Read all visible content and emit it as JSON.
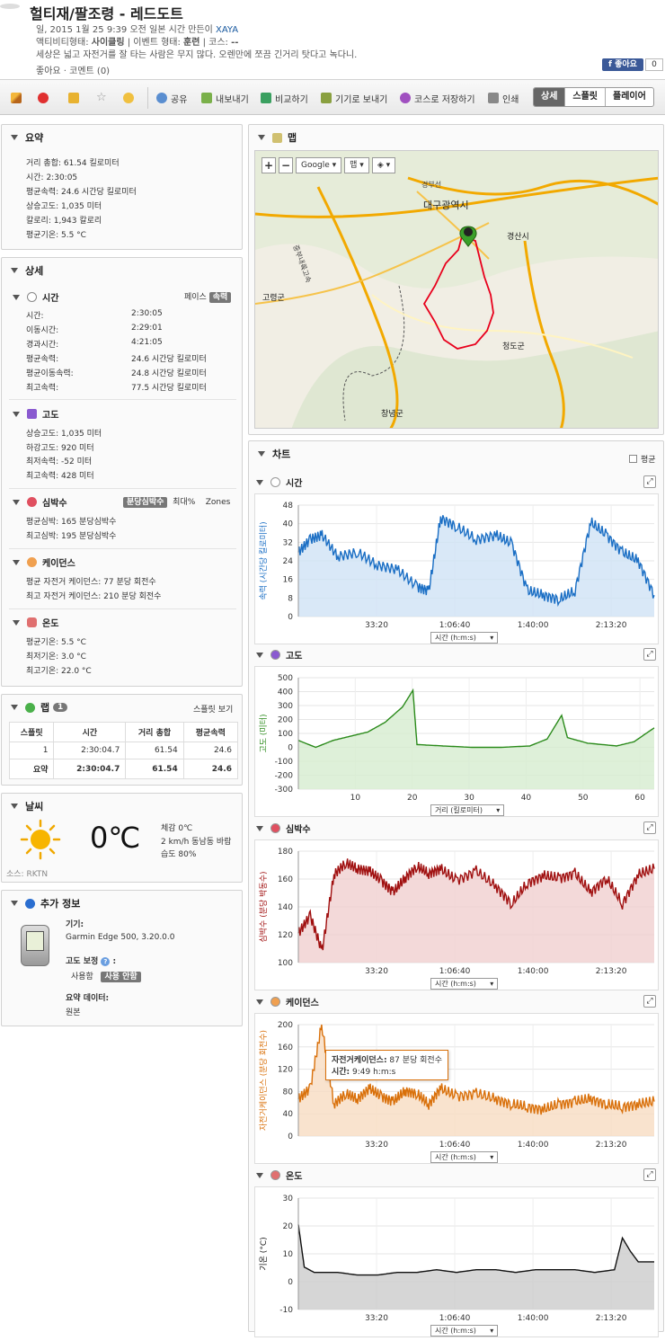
{
  "header": {
    "title": "헐티재/팔조령 - 레드도트",
    "meta_prefix": "일, 2015 1월 25 9:39 오전 일본 시간 만든이 ",
    "author": "XAYA",
    "activity_type_label": "액티비티형태: ",
    "activity_type": "사이클링",
    "event_type_label": " | 이벤트 형태: ",
    "event_type": "훈련",
    "course_label": " | 코스: ",
    "course": "--",
    "description": "세상은 넓고 자전거를 잘 타는 사람은 무지 많다. 오렌만에 쪼끔 긴거리 탓다고 녹다니.",
    "like_comment": "좋아요 · 코멘트 (0)",
    "fb_like": "좋아요",
    "fb_count": "0"
  },
  "toolbar": {
    "share": "공유",
    "export": "내보내기",
    "compare": "비교하기",
    "send_device": "기기로 보내기",
    "save_course": "코스로 저장하기",
    "print": "인쇄",
    "views": [
      "상세",
      "스플릿",
      "플레이어"
    ]
  },
  "summary": {
    "title": "요약",
    "rows": [
      "거리 총합:  61.54 킬로미터",
      "시간:  2:30:05",
      "평균속력:  24.6 시간당 킬로미터",
      "상승고도:  1,035 미터",
      "칼로리:  1,943 칼로리",
      "평균기온:  5.5 °C"
    ]
  },
  "details": {
    "title": "상세",
    "time": {
      "title": "시간",
      "toggle_a": "페이스",
      "toggle_b": "속력",
      "rows": [
        [
          "시간:",
          "2:30:05"
        ],
        [
          "이동시간:",
          "2:29:01"
        ],
        [
          "경과시간:",
          "4:21:05"
        ],
        [
          "평균속력:",
          "24.6 시간당 킬로미터"
        ],
        [
          "평균이동속력:",
          "24.8 시간당 킬로미터"
        ],
        [
          "최고속력:",
          "77.5 시간당 킬로미터"
        ]
      ]
    },
    "elevation": {
      "title": "고도",
      "rows": [
        "상승고도: 1,035 미터",
        "하강고도: 920 미터",
        "최저속력: -52 미터",
        "최고속력: 428 미터"
      ]
    },
    "hr": {
      "title": "심박수",
      "toggle_a": "분당심박수",
      "toggle_b": "최대%",
      "toggle_c": "Zones",
      "rows": [
        "평균심박: 165 분당심박수",
        "최고심박: 195 분당심박수"
      ]
    },
    "cadence": {
      "title": "케이던스",
      "rows": [
        "평균 자전거 케이던스: 77 분당 회전수",
        "최고 자전거 케이던스: 210 분당 회전수"
      ]
    },
    "temp": {
      "title": "온도",
      "rows": [
        "평균기온: 5.5 °C",
        "최저기온: 3.0 °C",
        "최고기온: 22.0 °C"
      ]
    }
  },
  "laps": {
    "title": "랩",
    "count": "1",
    "split_view": "스플릿 보기",
    "headers": [
      "스플릿",
      "시간",
      "거리 총합",
      "평균속력"
    ],
    "rows": [
      [
        "1",
        "2:30:04.7",
        "61.54",
        "24.6"
      ],
      [
        "요약",
        "2:30:04.7",
        "61.54",
        "24.6"
      ]
    ]
  },
  "weather": {
    "title": "날씨",
    "temp": "0℃",
    "feels": "체감 0℃",
    "wind": "2 km/h 동남동 바람",
    "humidity": "습도 80%",
    "source": "소스: RKTN"
  },
  "extra": {
    "title": "추가 정보",
    "device_label": "기기:",
    "device": "Garmin Edge 500, 3.20.0.0",
    "elev_corr_label": "고도 보정",
    "elev_corr_suffix": " :",
    "corr_on": "사용함",
    "corr_off": "사용 안함",
    "summary_data_label": "요약 데이터:",
    "summary_data": "원본"
  },
  "map": {
    "title": "맵",
    "provider": "Google",
    "maptype": "맵",
    "labels": {
      "city": "대구광역시",
      "gyeongsan": "경산시",
      "goryeong": "고령군",
      "cheongdo": "청도군",
      "changnyeong": "창녕군",
      "gumi": "경부선",
      "expressway": "중부내륙고속"
    },
    "route_color": "#e8001c"
  },
  "charts_panel": {
    "title": "차트",
    "avg_label": "평균"
  },
  "charts": [
    {
      "id": "speed",
      "title": "시간",
      "ylabel": "속력 (시간당 킬로미터)",
      "xsel": "시간 (h:m:s)",
      "color": "#1a6ec4",
      "fill": "#cfe2f5",
      "yticks": [
        "48",
        "40",
        "32",
        "24",
        "16",
        "8",
        "0"
      ],
      "xticks": [
        "33:20",
        "1:06:40",
        "1:40:00",
        "2:13:20"
      ]
    },
    {
      "id": "elev",
      "title": "고도",
      "ylabel": "고도 (미터)",
      "xsel": "거리 (킬로미터)",
      "color": "#2a8a1a",
      "fill": "#d6ecd0",
      "yticks": [
        "500",
        "400",
        "300",
        "200",
        "100",
        "0",
        "-100",
        "-200",
        "-300"
      ],
      "xticks": [
        "10",
        "20",
        "30",
        "40",
        "50",
        "60"
      ]
    },
    {
      "id": "hr",
      "title": "심박수",
      "ylabel": "심박수 (분당 박동수)",
      "xsel": "시간 (h:m:s)",
      "color": "#a01010",
      "fill": "#f0cfcf",
      "yticks": [
        "180",
        "160",
        "140",
        "120",
        "100"
      ],
      "xticks": [
        "33:20",
        "1:06:40",
        "1:40:00",
        "2:13:20"
      ]
    },
    {
      "id": "cad",
      "title": "케이던스",
      "ylabel": "자전거케이던스 (분당 회전수)",
      "xsel": "시간 (h:m:s)",
      "color": "#d9700a",
      "fill": "#f8dcc2",
      "yticks": [
        "200",
        "160",
        "120",
        "80",
        "40",
        "0"
      ],
      "xticks": [
        "33:20",
        "1:06:40",
        "1:40:00",
        "2:13:20"
      ],
      "tooltip": {
        "l1a": "자전거케이던스:",
        "l1b": " 87 분당 회전수",
        "l2a": "시간:",
        "l2b": " 9:49 h:m:s"
      }
    },
    {
      "id": "temp",
      "title": "온도",
      "ylabel": "기온 (°C)",
      "xsel": "시간 (h:m:s)",
      "color": "#111111",
      "fill": "#cccccc",
      "yticks": [
        "30",
        "20",
        "10",
        "0",
        "-10"
      ],
      "xticks": [
        "33:20",
        "1:06:40",
        "1:40:00",
        "2:13:20"
      ]
    }
  ],
  "chart_data": [
    {
      "type": "area",
      "title": "",
      "xlabel": "시간 (h:m:s)",
      "ylabel": "속력 (시간당 킬로미터)",
      "ylim": [
        0,
        52
      ],
      "x_unit": "seconds",
      "x": [
        0,
        300,
        600,
        1000,
        1500,
        2000,
        2500,
        3000,
        3300,
        3600,
        4000,
        4500,
        5000,
        5400,
        5800,
        6200,
        6600,
        7000,
        7400,
        7800,
        8200,
        8600,
        9005
      ],
      "values": [
        30,
        36,
        38,
        28,
        30,
        24,
        22,
        14,
        12,
        46,
        42,
        36,
        38,
        34,
        12,
        10,
        8,
        12,
        44,
        38,
        30,
        26,
        10
      ],
      "grid": true
    },
    {
      "type": "area",
      "title": "",
      "xlabel": "거리 (킬로미터)",
      "ylabel": "고도 (미터)",
      "ylim": [
        -300,
        500
      ],
      "x": [
        0,
        3,
        6,
        9,
        12,
        15,
        18,
        19.8,
        20.5,
        25,
        30,
        35,
        40,
        43,
        45.5,
        46.5,
        50,
        55,
        58,
        61.5
      ],
      "values": [
        50,
        0,
        50,
        80,
        110,
        180,
        290,
        410,
        20,
        10,
        0,
        0,
        10,
        60,
        230,
        70,
        30,
        10,
        40,
        140
      ],
      "grid": true
    },
    {
      "type": "area",
      "title": "",
      "xlabel": "시간 (h:m:s)",
      "ylabel": "심박수 (분당 박동수)",
      "ylim": [
        100,
        195
      ],
      "x_unit": "seconds",
      "x": [
        0,
        300,
        600,
        900,
        1200,
        1500,
        1800,
        2100,
        2400,
        2700,
        3000,
        3300,
        3600,
        4000,
        4500,
        5000,
        5400,
        5800,
        6200,
        6600,
        7000,
        7400,
        7800,
        8200,
        8600,
        9005
      ],
      "values": [
        125,
        140,
        110,
        175,
        185,
        180,
        178,
        170,
        160,
        172,
        182,
        176,
        180,
        170,
        178,
        165,
        150,
        168,
        174,
        172,
        176,
        160,
        172,
        150,
        175,
        180
      ],
      "grid": true
    },
    {
      "type": "area",
      "title": "",
      "xlabel": "시간 (h:m:s)",
      "ylabel": "자전거케이던스 (분당 회전수)",
      "ylim": [
        0,
        210
      ],
      "x_unit": "seconds",
      "x": [
        0,
        300,
        589,
        900,
        1200,
        1500,
        1800,
        2100,
        2400,
        2700,
        3000,
        3300,
        3600,
        4000,
        4500,
        5000,
        5400,
        5800,
        6200,
        6600,
        7000,
        7400,
        7800,
        8200,
        8600,
        9005
      ],
      "values": [
        70,
        90,
        210,
        60,
        80,
        70,
        90,
        75,
        65,
        85,
        80,
        60,
        90,
        75,
        80,
        70,
        60,
        55,
        50,
        60,
        65,
        70,
        60,
        55,
        60,
        65
      ],
      "grid": true
    },
    {
      "type": "area",
      "title": "",
      "xlabel": "시간 (h:m:s)",
      "ylabel": "기온 (°C)",
      "ylim": [
        -10,
        32
      ],
      "x_unit": "seconds",
      "x": [
        0,
        150,
        400,
        1000,
        1500,
        2000,
        2500,
        3000,
        3500,
        4000,
        4500,
        5000,
        5500,
        6000,
        6500,
        7000,
        7500,
        8000,
        8200,
        8400,
        8600,
        9005
      ],
      "values": [
        22,
        6,
        4,
        4,
        3,
        3,
        4,
        4,
        5,
        4,
        5,
        5,
        4,
        5,
        5,
        5,
        4,
        5,
        17,
        12,
        8,
        8
      ],
      "grid": true
    }
  ]
}
